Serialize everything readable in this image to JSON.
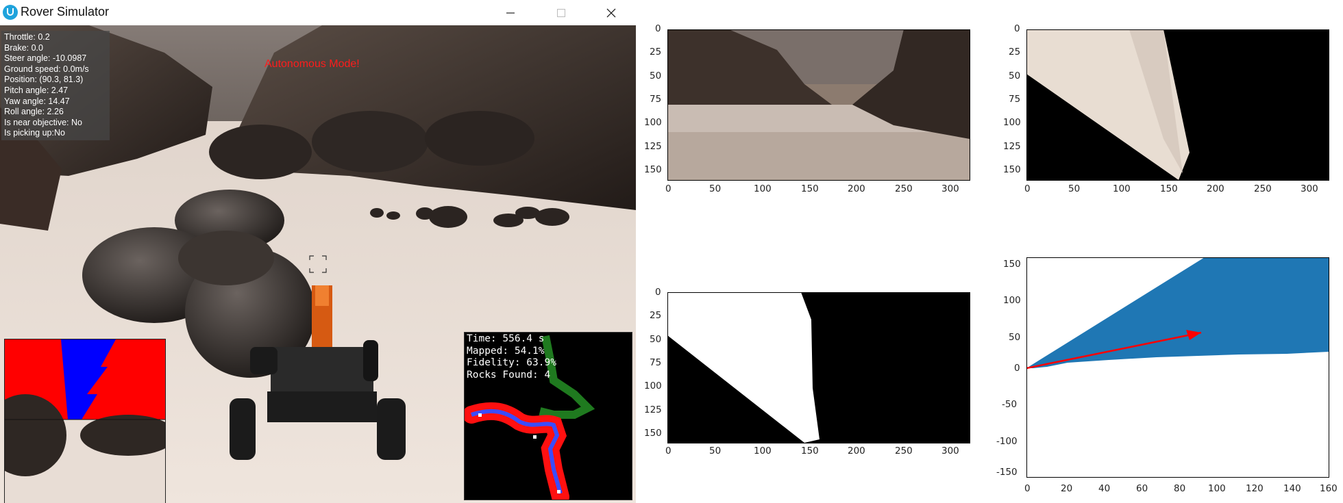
{
  "window": {
    "title": "Rover Simulator",
    "icon": "unity-icon",
    "controls": [
      "minimize-icon",
      "maximize-icon",
      "close-icon"
    ]
  },
  "telemetry": {
    "throttle": "Throttle: 0.2",
    "brake": "Brake: 0.0",
    "steer": "Steer angle: -10.0987",
    "speed": "Ground speed: 0.0m/s",
    "position": "Position: (90.3, 81.3)",
    "pitch": "Pitch angle: 2.47",
    "yaw": "Yaw angle: 14.47",
    "roll": "Roll angle: 2.26",
    "near": "Is near objective: No",
    "picking": "Is picking up:No"
  },
  "mode_text": "Autonomous Mode!",
  "map_stats": {
    "time": "Time: 556.4 s",
    "mapped": "Mapped: 54.1%",
    "fidelity": "Fidelity: 63.9%",
    "rocks": "Rocks Found: 4"
  },
  "colors": {
    "sky": "#7d746f",
    "ground": "#e9ddd4",
    "rock": "#3a302b",
    "nav_blue": "#0000ff",
    "obstacle_red": "#ff0000",
    "plot_blue": "#1f77b4",
    "arrow_red": "#ff0000"
  },
  "plots": {
    "camera": {
      "x_ticks": [
        "0",
        "50",
        "100",
        "150",
        "200",
        "250",
        "300"
      ],
      "y_ticks": [
        "0",
        "25",
        "50",
        "75",
        "100",
        "125",
        "150"
      ]
    },
    "warped": {
      "x_ticks": [
        "0",
        "50",
        "100",
        "150",
        "200",
        "250",
        "300"
      ],
      "y_ticks": [
        "0",
        "25",
        "50",
        "75",
        "100",
        "125",
        "150"
      ]
    },
    "threshed": {
      "x_ticks": [
        "0",
        "50",
        "100",
        "150",
        "200",
        "250",
        "300"
      ],
      "y_ticks": [
        "0",
        "25",
        "50",
        "75",
        "100",
        "125",
        "150"
      ]
    },
    "rover_coords": {
      "x_ticks": [
        "0",
        "20",
        "40",
        "60",
        "80",
        "100",
        "120",
        "140",
        "160"
      ],
      "y_ticks": [
        "150",
        "100",
        "50",
        "0",
        "-50",
        "-100",
        "-150"
      ]
    }
  }
}
